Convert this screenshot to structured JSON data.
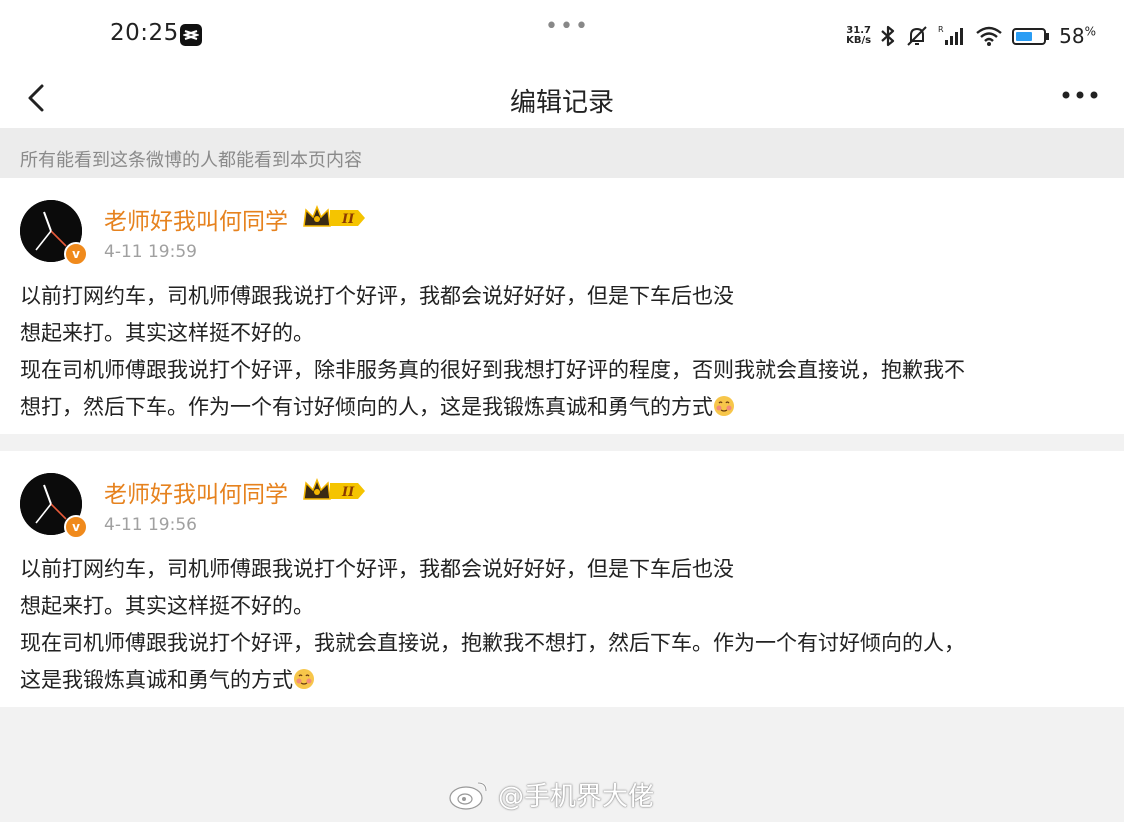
{
  "status_bar": {
    "time": "20:25",
    "net_speed_value": "31.7",
    "net_speed_unit": "KB/s",
    "battery_percent": "58",
    "battery_unit": "%"
  },
  "nav": {
    "title": "编辑记录"
  },
  "notice": "所有能看到这条微博的人都能看到本页内容",
  "records": [
    {
      "username": "老师好我叫何同学",
      "vip_level": "II",
      "time": "4-11 19:59",
      "lines": [
        "以前打网约车，司机师傅跟我说打个好评，我都会说好好好，但是下车后也没",
        "想起来打。其实这样挺不好的。",
        "现在司机师傅跟我说打个好评，除非服务真的很好到我想打好评的程度，否则我就会直接说，抱歉我不",
        "想打，然后下车。作为一个有讨好倾向的人，这是我锻炼真诚和勇气的方式"
      ]
    },
    {
      "username": "老师好我叫何同学",
      "vip_level": "II",
      "time": "4-11 19:56",
      "lines": [
        "以前打网约车，司机师傅跟我说打个好评，我都会说好好好，但是下车后也没",
        "想起来打。其实这样挺不好的。",
        "现在司机师傅跟我说打个好评，我就会直接说，抱歉我不想打，然后下车。作为一个有讨好倾向的人，",
        "这是我锻炼真诚和勇气的方式"
      ]
    }
  ],
  "watermark": "@手机界大佬",
  "colors": {
    "username": "#e6821e",
    "verified_badge": "#f08a1c",
    "vip_gold": "#f5b800"
  },
  "icons": [
    "back-arrow-icon",
    "more-dots-icon",
    "bluetooth-icon",
    "mute-bell-icon",
    "signal-icon",
    "wifi-icon",
    "battery-icon",
    "crown-icon",
    "blush-emoji-icon",
    "weibo-logo-icon"
  ]
}
